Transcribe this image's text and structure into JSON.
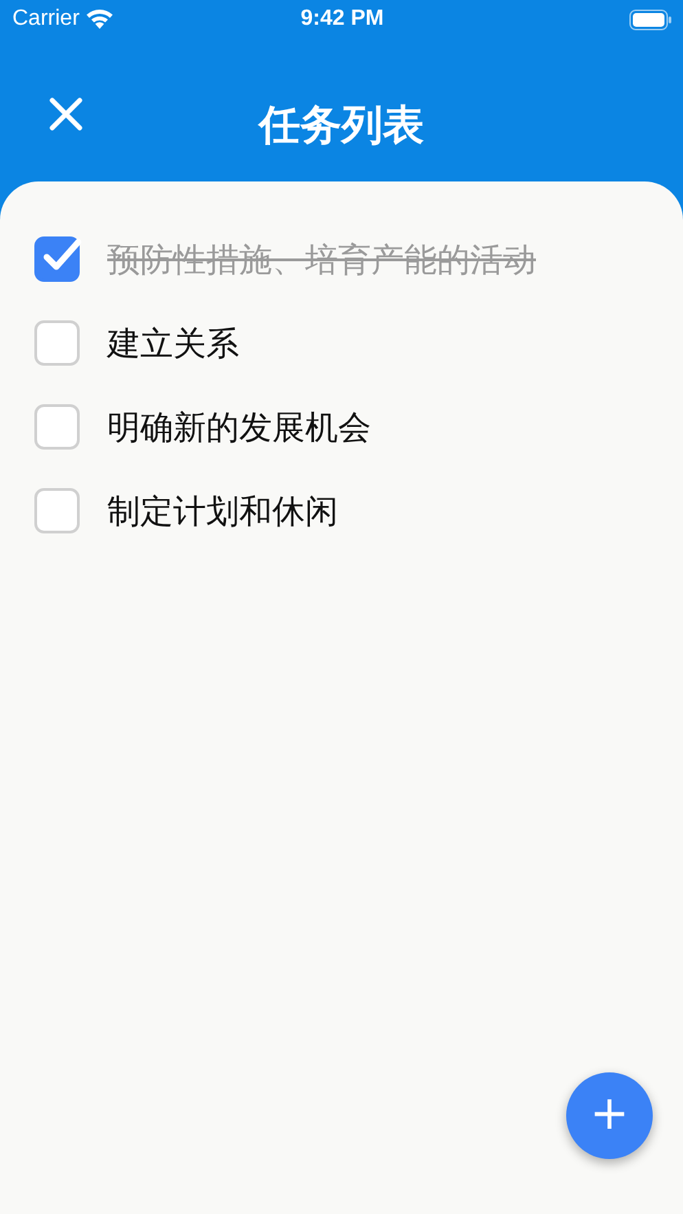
{
  "status_bar": {
    "carrier": "Carrier",
    "time": "9:42 PM"
  },
  "header": {
    "title": "任务列表"
  },
  "tasks": [
    {
      "label": "预防性措施、培育产能的活动",
      "checked": true
    },
    {
      "label": "建立关系",
      "checked": false
    },
    {
      "label": "明确新的发展机会",
      "checked": false
    },
    {
      "label": "制定计划和休闲",
      "checked": false
    }
  ],
  "fab": {
    "label": "+"
  }
}
